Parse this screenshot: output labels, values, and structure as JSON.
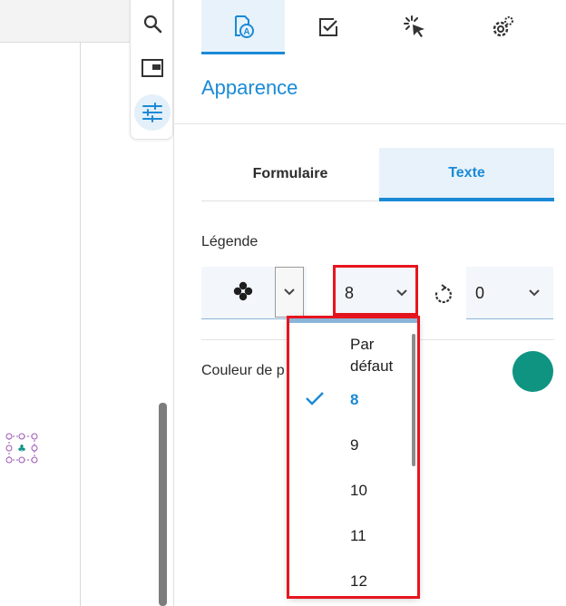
{
  "panel": {
    "title": "Apparence",
    "tabs": [
      {
        "icon": "appearance-icon",
        "active": true
      },
      {
        "icon": "checkbox-icon",
        "active": false
      },
      {
        "icon": "click-action-icon",
        "active": false
      },
      {
        "icon": "settings-icon",
        "active": false
      }
    ],
    "subtabs": {
      "form": "Formulaire",
      "text": "Texte"
    },
    "legend_label": "Légende",
    "font_size_value": "8",
    "rotation_value": "0",
    "color_label": "Couleur de p",
    "color_value": "#0f9482",
    "accent_color": "#1a8ad6"
  },
  "vtoolbar": [
    {
      "icon": "search-icon"
    },
    {
      "icon": "panel-toggle-icon"
    },
    {
      "icon": "properties-sliders-icon",
      "active": true
    }
  ],
  "dropdown": {
    "options": [
      "Par\ndéfaut",
      "8",
      "9",
      "10",
      "11",
      "12"
    ],
    "default_line1": "Par",
    "default_line2": "défaut",
    "selected": "8"
  }
}
